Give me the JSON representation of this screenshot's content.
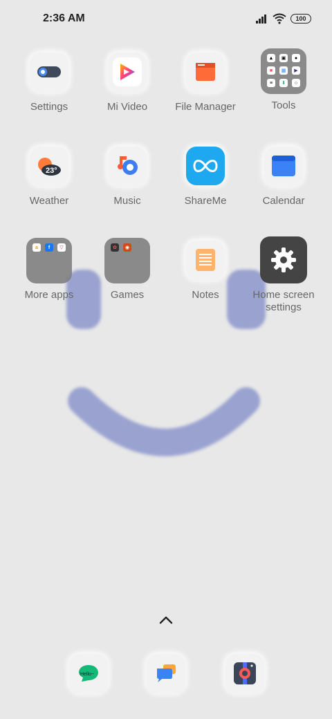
{
  "status_bar": {
    "time": "2:36 AM",
    "battery": "100"
  },
  "apps": {
    "settings": "Settings",
    "mi_video": "Mi Video",
    "file_manager": "File Manager",
    "tools": "Tools",
    "weather": "Weather",
    "weather_temp": "23°",
    "music": "Music",
    "shareme": "ShareMe",
    "calendar": "Calendar",
    "more_apps": "More apps",
    "games": "Games",
    "notes": "Notes",
    "home_screen_settings_line1": "Home screen",
    "home_screen_settings_line2": "settings"
  },
  "dock": {
    "chat_bubble_text": "Hello~"
  },
  "colors": {
    "accent_blue": "#4a8af4",
    "face_color": "#9aa2d0"
  }
}
